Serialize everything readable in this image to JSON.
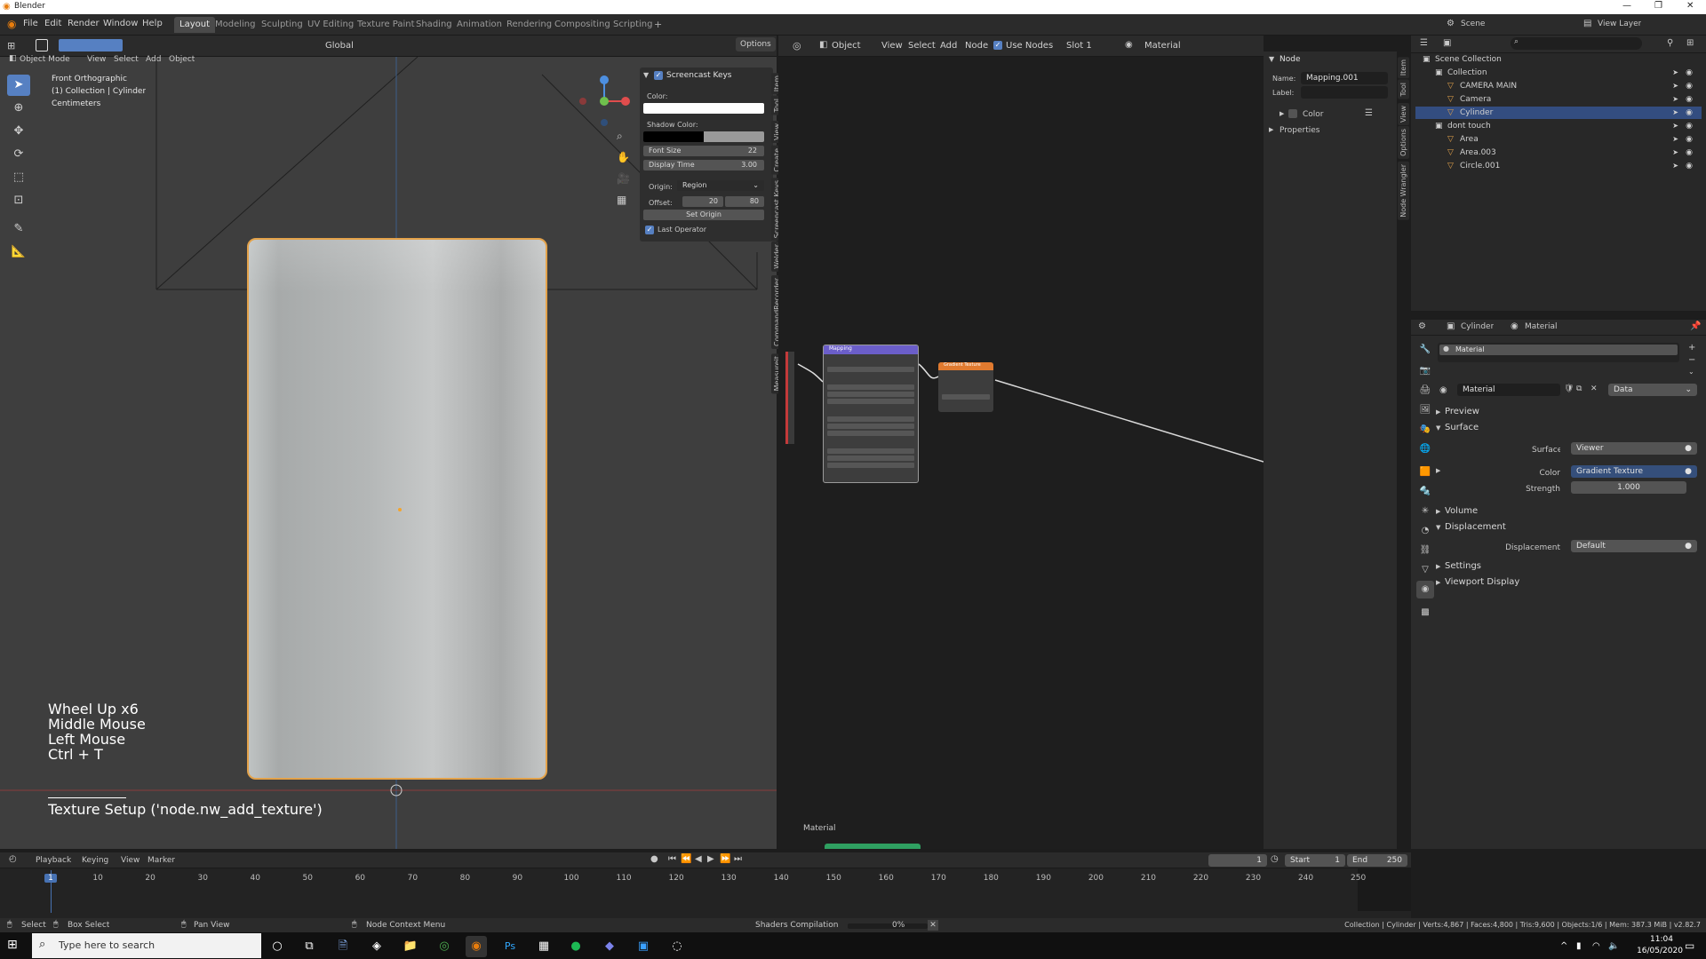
{
  "window": {
    "app_name": "Blender",
    "controls": [
      "—",
      "❐",
      "✕"
    ]
  },
  "menu": [
    "File",
    "Edit",
    "Render",
    "Window",
    "Help"
  ],
  "workspaces": [
    "Layout",
    "Modeling",
    "Sculpting",
    "UV Editing",
    "Texture Paint",
    "Shading",
    "Animation",
    "Rendering",
    "Compositing",
    "Scripting"
  ],
  "top_right": {
    "scene": "Scene",
    "view_layer": "View Layer"
  },
  "viewport_header": {
    "mode": "Object Mode",
    "menus": [
      "View",
      "Select",
      "Add",
      "Object"
    ],
    "orientation": "Global",
    "options": "Options"
  },
  "viewport_info": {
    "view": "Front Orthographic",
    "collection": "(1) Collection | Cylinder",
    "units": "Centimeters"
  },
  "screencast_panel": {
    "title": "Screencast Keys",
    "color_label": "Color:",
    "shadow_label": "Shadow Color:",
    "font_size_label": "Font Size",
    "font_size": "22",
    "display_time_label": "Display Time",
    "display_time": "3.00",
    "origin_label": "Origin:",
    "origin": "Region",
    "offset_label": "Offset:",
    "offset_x": "20",
    "offset_y": "80",
    "set_origin": "Set Origin",
    "last_operator": "Last Operator"
  },
  "viewport_vtabs": [
    "Item",
    "Tool",
    "View",
    "Create",
    "Screencast Keys",
    "Welder",
    "CommandRecorder",
    "Measureit"
  ],
  "keys_overlay": [
    "Wheel Up x6",
    "Middle Mouse",
    "Left Mouse",
    "Ctrl + T"
  ],
  "last_operator_text": "Texture Setup ('node.nw_add_texture')",
  "node_header": {
    "editor": "Object",
    "menus": [
      "View",
      "Select",
      "Add",
      "Node"
    ],
    "use_nodes": "Use Nodes",
    "slot": "Slot 1",
    "material": "Material"
  },
  "node_sidebar": {
    "section": "Node",
    "name_label": "Name:",
    "name": "Mapping.001",
    "label_label": "Label:",
    "color": "Color",
    "properties": "Properties"
  },
  "node_vtabs": [
    "Item",
    "Tool",
    "View",
    "Options",
    "Node Wrangler"
  ],
  "nodes": {
    "mapping_title": "Mapping",
    "gradient_title": "Gradient Texture",
    "frame_label": "Material"
  },
  "outliner": {
    "rows": [
      {
        "name": "Scene Collection",
        "indent": 0
      },
      {
        "name": "Collection",
        "indent": 1
      },
      {
        "name": "CAMERA MAIN",
        "indent": 2
      },
      {
        "name": "Camera",
        "indent": 2
      },
      {
        "name": "Cylinder",
        "indent": 2,
        "selected": true
      },
      {
        "name": "dont touch",
        "indent": 1
      },
      {
        "name": "Area",
        "indent": 2
      },
      {
        "name": "Area.003",
        "indent": 2
      },
      {
        "name": "Circle.001",
        "indent": 2
      }
    ]
  },
  "properties": {
    "object": "Cylinder",
    "tab": "Material",
    "slot": "Material",
    "material_name": "Material",
    "data": "Data",
    "sections": [
      "Preview",
      "Surface",
      "Volume",
      "Displacement",
      "Settings",
      "Viewport Display"
    ],
    "surface_label": "Surface",
    "surface_value": "Viewer",
    "color_label": "Color",
    "color_value": "Gradient Texture",
    "strength_label": "Strength",
    "strength_value": "1.000",
    "displacement_label": "Displacement",
    "displacement_value": "Default"
  },
  "timeline": {
    "menus": [
      "Playback",
      "Keying",
      "View",
      "Marker"
    ],
    "current": "1",
    "start_label": "Start",
    "start": "1",
    "end_label": "End",
    "end": "250",
    "ticks": [
      "1",
      "10",
      "20",
      "30",
      "40",
      "50",
      "60",
      "70",
      "80",
      "90",
      "100",
      "110",
      "120",
      "130",
      "140",
      "150",
      "160",
      "170",
      "180",
      "190",
      "200",
      "210",
      "220",
      "230",
      "240",
      "250"
    ]
  },
  "status": {
    "select": "Select",
    "box_select": "Box Select",
    "pan_view": "Pan View",
    "context": "Node Context Menu",
    "compile": "Shaders Compilation",
    "percent": "0%",
    "stats": "Collection | Cylinder | Verts:4,867 | Faces:4,800 | Tris:9,600 | Objects:1/6 | Mem: 387.3 MiB | v2.82.7"
  },
  "taskbar": {
    "search": "Type here to search",
    "time": "11:04",
    "date": "16/05/2020"
  },
  "colors": {
    "accent": "#4772b3",
    "selected_row": "#334d80",
    "mapping_node": "#6b5ec9",
    "gradient_node": "#e07a2f",
    "frame_bar": "#2fa061"
  }
}
